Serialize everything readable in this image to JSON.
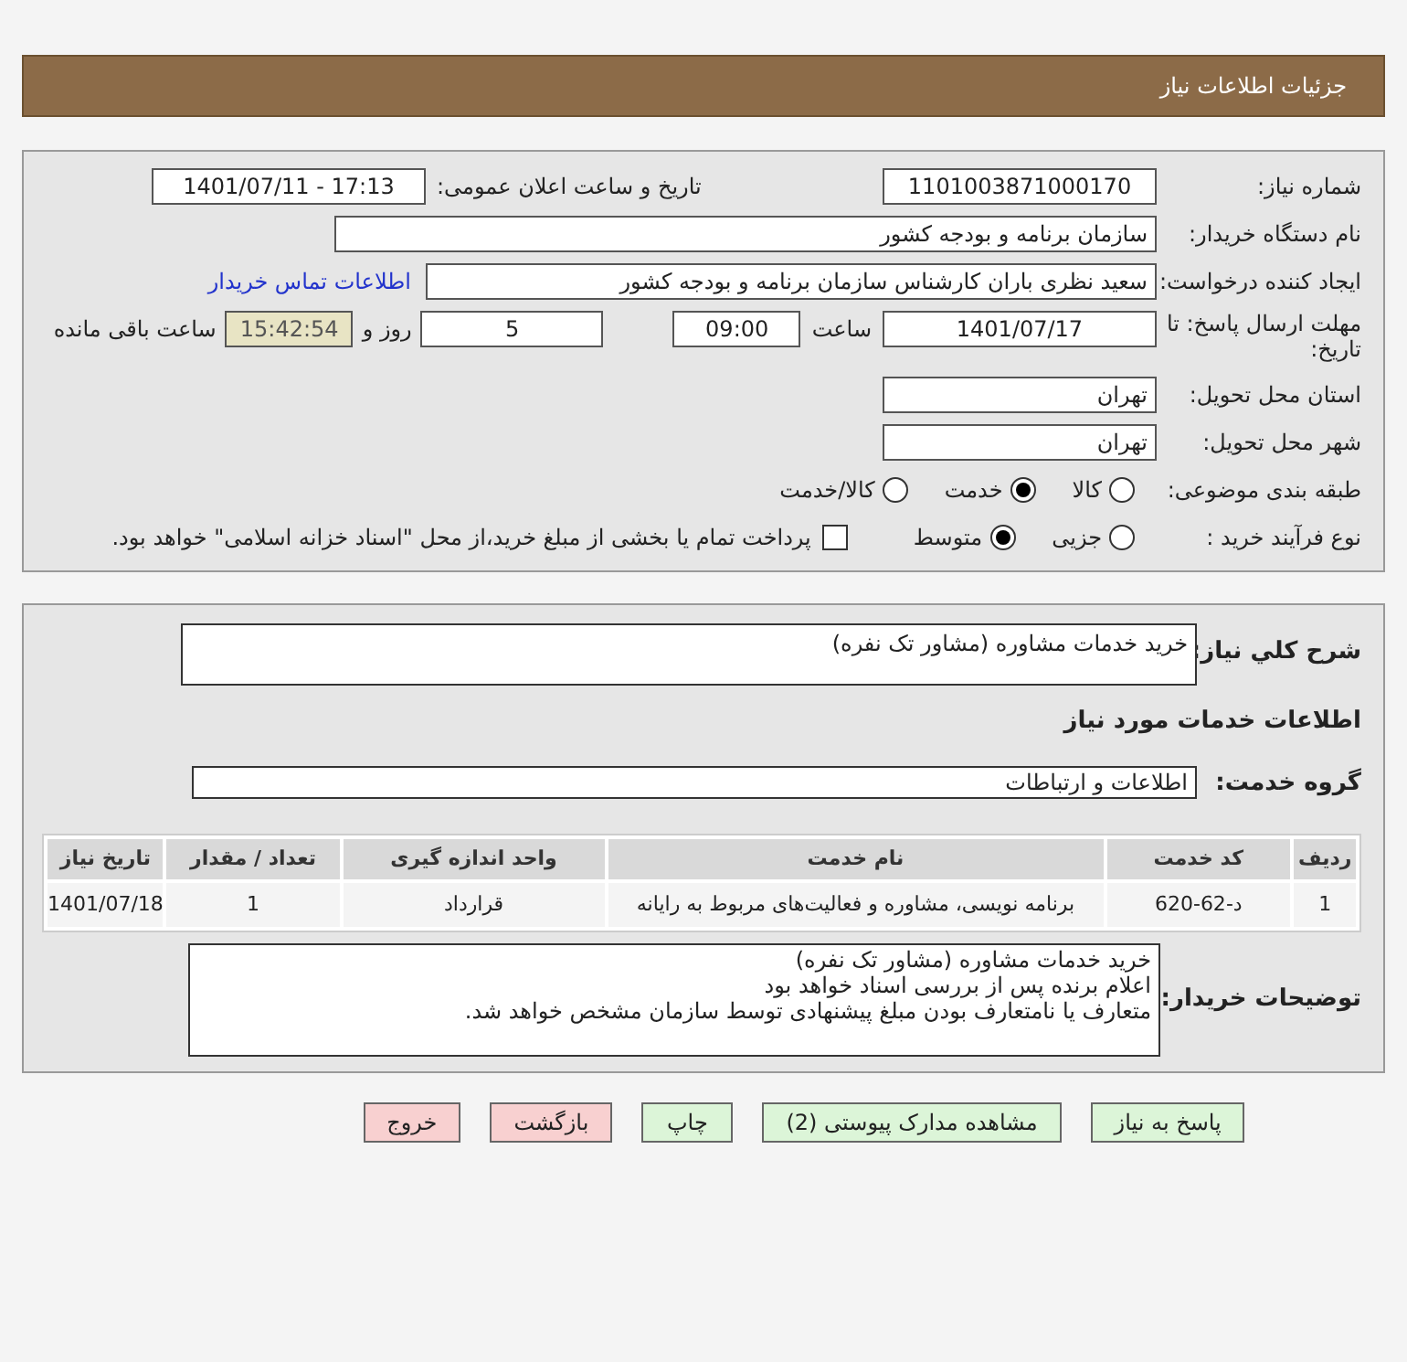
{
  "header": {
    "title": "جزئیات اطلاعات نیاز"
  },
  "details": {
    "need_number": {
      "label": "شماره نیاز:",
      "value": "1101003871000170"
    },
    "announce": {
      "label": "تاریخ و ساعت اعلان عمومی:",
      "value": "1401/07/11 - 17:13"
    },
    "buyer_org": {
      "label": "نام دستگاه خریدار:",
      "value": "سازمان برنامه و بودجه کشور"
    },
    "requester": {
      "label": "ایجاد کننده درخواست:",
      "value": "سعید نظری باران کارشناس سازمان برنامه و بودجه کشور",
      "link": "اطلاعات تماس خریدار"
    },
    "deadline": {
      "label": "مهلت ارسال پاسخ: تا تاریخ:",
      "date": "1401/07/17",
      "time_label": "ساعت",
      "time": "09:00",
      "days": "5",
      "days_label": "روز و",
      "remaining": "15:42:54",
      "remaining_label": "ساعت باقی مانده"
    },
    "province": {
      "label": "استان محل تحویل:",
      "value": "تهران"
    },
    "city": {
      "label": "شهر محل تحویل:",
      "value": "تهران"
    },
    "category": {
      "label": "طبقه بندی موضوعی:",
      "options": [
        {
          "label": "کالا",
          "selected": false
        },
        {
          "label": "خدمت",
          "selected": true
        },
        {
          "label": "کالا/خدمت",
          "selected": false
        }
      ]
    },
    "process": {
      "label": "نوع فرآیند خرید :",
      "options": [
        {
          "label": "جزیی",
          "selected": false
        },
        {
          "label": "متوسط",
          "selected": true
        }
      ],
      "payment": {
        "checked": false,
        "text": "پرداخت تمام یا بخشی از مبلغ خرید،از محل \"اسناد خزانه اسلامی\" خواهد بود."
      }
    }
  },
  "summary": {
    "label": "شرح کلي نياز:",
    "value": "خرید خدمات مشاوره (مشاور تک نفره)"
  },
  "services_title": "اطلاعات خدمات مورد نیاز",
  "service_group": {
    "label": "گروه خدمت:",
    "value": "اطلاعات و ارتباطات"
  },
  "table": {
    "columns": [
      "ردیف",
      "کد خدمت",
      "نام خدمت",
      "واحد اندازه گیری",
      "تعداد / مقدار",
      "تاریخ نیاز"
    ],
    "rows": [
      [
        "1",
        "د-62-620",
        "برنامه نویسی، مشاوره و فعالیت‌های مربوط به رایانه",
        "قرارداد",
        "1",
        "1401/07/18"
      ]
    ]
  },
  "buyer_notes": {
    "label": "توضیحات خریدار:",
    "lines": [
      "خرید خدمات مشاوره (مشاور تک نفره)",
      "اعلام برنده پس از بررسی اسناد خواهد بود",
      "متعارف یا نامتعارف بودن مبلغ پیشنهادی توسط سازمان مشخص خواهد شد."
    ]
  },
  "buttons": [
    {
      "label": "پاسخ به نیاز",
      "kind": "action"
    },
    {
      "label": "مشاهده مدارک پیوستی (2)",
      "kind": "action"
    },
    {
      "label": "چاپ",
      "kind": "action"
    },
    {
      "label": "بازگشت",
      "kind": "exit"
    },
    {
      "label": "خروج",
      "kind": "exit"
    }
  ]
}
